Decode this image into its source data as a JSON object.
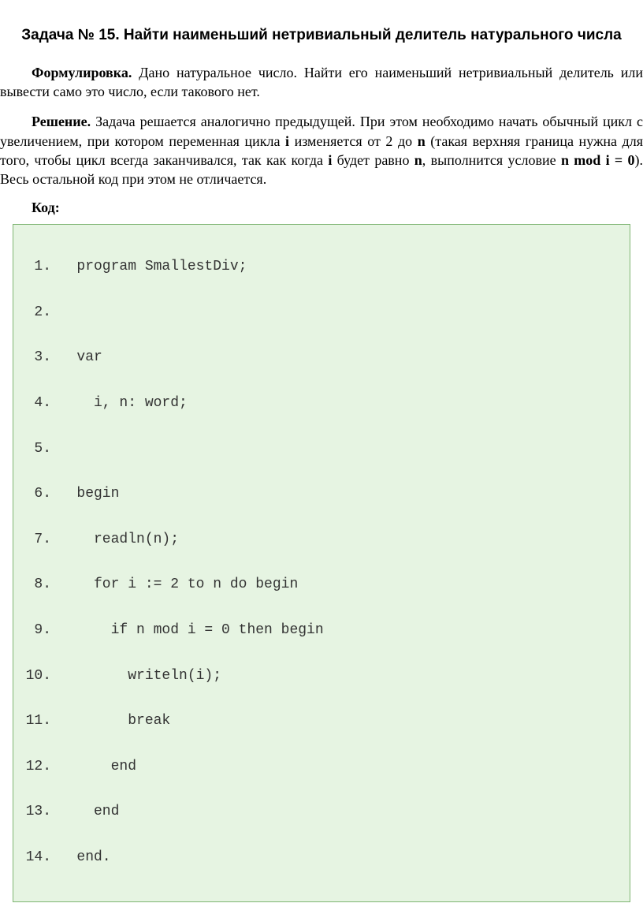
{
  "title": "Задача № 15. Найти наименьший нетривиальный делитель натурального числа",
  "formulation": {
    "label": "Формулировка.",
    "text": " Дано натуральное число. Найти его наименьший нетривиальный делитель или вывести само это число, если такового нет."
  },
  "solution": {
    "label": "Решение.",
    "t1": " Задача решается аналогично предыдущей. При этом необходимо начать обычный цикл с увеличением, при котором переменная цикла ",
    "v1": "i",
    "t2": " изменяется от 2 до ",
    "v2": "n",
    "t3": " (такая верхняя граница нужна для того, чтобы цикл всегда заканчивался, так как когда ",
    "v3": "i",
    "t4": " будет равно ",
    "v4": "n",
    "t5": ", выполнится условие ",
    "v5": "n mod i = 0",
    "t6": "). Весь остальной код при этом не отличается."
  },
  "code_label": "Код:",
  "code": {
    "lines": [
      {
        "n": "1.",
        "c": "   program SmallestDiv;"
      },
      {
        "n": "2.",
        "c": ""
      },
      {
        "n": "3.",
        "c": "   var"
      },
      {
        "n": "4.",
        "c": "     i, n: word;"
      },
      {
        "n": "5.",
        "c": ""
      },
      {
        "n": "6.",
        "c": "   begin"
      },
      {
        "n": "7.",
        "c": "     readln(n);"
      },
      {
        "n": "8.",
        "c": "     for i := 2 to n do begin"
      },
      {
        "n": "9.",
        "c": "       if n mod i = 0 then begin"
      },
      {
        "n": "10.",
        "c": "         writeln(i);"
      },
      {
        "n": "11.",
        "c": "         break"
      },
      {
        "n": "12.",
        "c": "       end"
      },
      {
        "n": "13.",
        "c": "     end"
      },
      {
        "n": "14.",
        "c": "   end."
      }
    ]
  }
}
